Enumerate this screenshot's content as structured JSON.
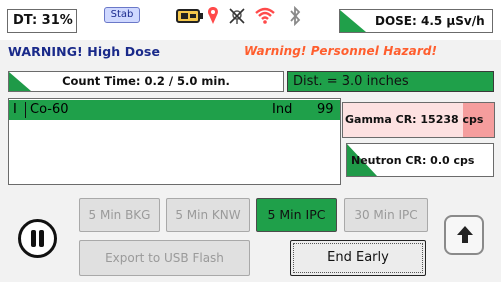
{
  "status_bar": {
    "dead_time_label": "DT: 31%",
    "stab_label": "Stab",
    "dose_label": "DOSE: 4.5 µSv/h",
    "icons": [
      "battery-icon",
      "gps-pin-icon",
      "no-gps-icon",
      "wifi-icon",
      "bluetooth-icon"
    ],
    "colors": {
      "battery": "#222222",
      "gps": "#ff4a4a",
      "wifi": "#ff4a4a",
      "bluetooth": "#8a8a8a"
    }
  },
  "warnings": {
    "primary": "WARNING! High Dose",
    "secondary": "Warning! Personnel Hazard!"
  },
  "count_time": {
    "label": "Count Time: 0.2 / 5.0 min."
  },
  "distance": {
    "label": "Dist. = 3.0 inches"
  },
  "isotopes": [
    {
      "flag": "I",
      "name": "Co-60",
      "type": "Ind",
      "confidence": "99"
    }
  ],
  "rates": {
    "gamma_label": "Gamma CR: 15238 cps",
    "neutron_label": "Neutron CR: 0.0 cps"
  },
  "buttons": {
    "bkg_5": "5 Min BKG",
    "knw_5": "5 Min KNW",
    "ipc_5": "5 Min IPC",
    "ipc_30": "30 Min IPC",
    "export_usb": "Export to USB Flash",
    "end_early": "End Early"
  },
  "colors": {
    "accent_green": "#1fa04a",
    "gamma_alarm": "#f59d9d",
    "warning_orange": "#ff5e2e",
    "warning_blue": "#1a2a8a"
  }
}
